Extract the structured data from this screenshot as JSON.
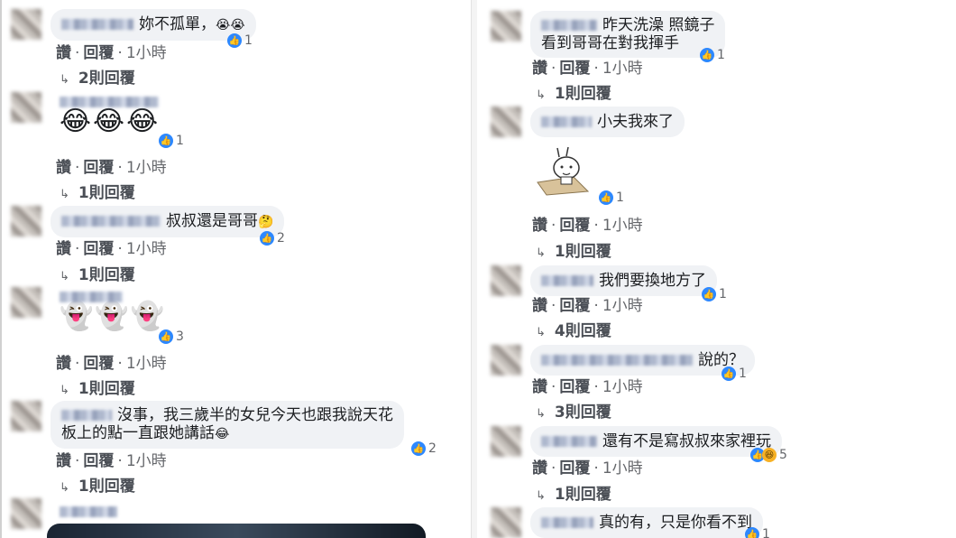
{
  "left": {
    "comments": [
      {
        "text": "妳不孤單，",
        "emoji": "😭😭",
        "likes": "1",
        "actions": [
          "讚",
          "回覆",
          "1小時"
        ],
        "replies": "2則回覆"
      },
      {
        "text": "",
        "emoji": "😂😂😂",
        "likes": "1",
        "actions": [
          "讚",
          "回覆",
          "1小時"
        ],
        "replies": "1則回覆"
      },
      {
        "text": "叔叔還是哥哥",
        "emoji": "🤔",
        "likes": "2",
        "actions": [
          "讚",
          "回覆",
          "1小時"
        ],
        "replies": "1則回覆"
      },
      {
        "text": "",
        "emoji": "👻👻👻",
        "likes": "3",
        "actions": [
          "讚",
          "回覆",
          "1小時"
        ],
        "replies": "1則回覆"
      },
      {
        "text": "沒事，我三歲半的女兒今天也跟我說天花",
        "text2": "板上的點一直跟她講話",
        "emoji": "😂",
        "likes": "2",
        "actions": [
          "讚",
          "回覆",
          "1小時"
        ],
        "replies": "1則回覆"
      }
    ]
  },
  "right": {
    "comments": [
      {
        "text": "昨天洗澡 照鏡子",
        "text2": "看到哥哥在對我揮手",
        "likes": "1",
        "actions": [
          "讚",
          "回覆",
          "1小時"
        ],
        "replies": "1則回覆"
      },
      {
        "text": "小夫我來了",
        "likes": "1",
        "actions": [
          "讚",
          "回覆",
          "1小時"
        ],
        "replies": "1則回覆"
      },
      {
        "text": "我們要換地方了",
        "likes": "1",
        "actions": [
          "讚",
          "回覆",
          "1小時"
        ],
        "replies": "4則回覆"
      },
      {
        "text": "說的？",
        "likes": "1",
        "actions": [
          "讚",
          "回覆",
          "1小時"
        ],
        "replies": "3則回覆"
      },
      {
        "text": "還有不是寫叔叔來家裡玩",
        "likes": "5",
        "actions": [
          "讚",
          "回覆",
          "1小時"
        ],
        "replies": "1則回覆"
      },
      {
        "text": "真的有，只是你看不到",
        "likes": "1"
      }
    ]
  },
  "icons": {
    "like": "thumbs-up-icon",
    "haha": "haha-icon",
    "reply_arrow": "reply-arrow-icon"
  },
  "colors": {
    "bubble": "#f0f2f5",
    "like": "#2d88ff",
    "meta": "#65676b"
  }
}
